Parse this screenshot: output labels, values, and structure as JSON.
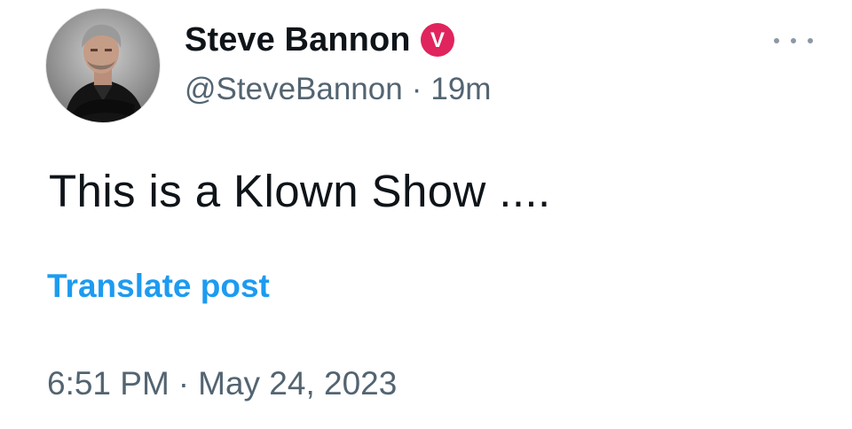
{
  "post": {
    "author": {
      "display_name": "Steve Bannon",
      "handle": "@SteveBannon",
      "avatar_icon": "avatar-photo",
      "verified_badge_letter": "V",
      "verified_badge_color": "#e0245e"
    },
    "relative_time": "19m",
    "separator": "·",
    "text": "This is a Klown Show ....",
    "translate_label": "Translate post",
    "timestamp_time": "6:51 PM",
    "timestamp_date": "May 24, 2023",
    "more_icon": "more-horizontal-icon"
  },
  "colors": {
    "text_primary": "#0f1419",
    "text_secondary": "#536471",
    "link": "#1d9bf0",
    "background": "#ffffff"
  }
}
